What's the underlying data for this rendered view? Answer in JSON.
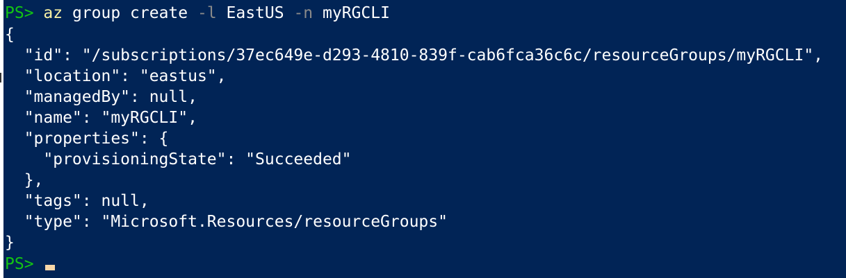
{
  "colors": {
    "background": "#012456",
    "prompt": "#13c413",
    "command": "#f9f1a5",
    "parameter": "#8a8a8a",
    "text": "#ffffff",
    "cursor": "#f8d7a8"
  },
  "command_line": {
    "prompt": "PS> ",
    "cmd": "az",
    "arg1": " group create ",
    "param1": "-l",
    "arg2": " EastUS ",
    "param2": "-n",
    "arg3": " myRGCLI"
  },
  "output": {
    "lines": [
      "{",
      "  \"id\": \"/subscriptions/37ec649e-d293-4810-839f-cab6fca36c6c/resourceGroups/myRGCLI\",",
      "  \"location\": \"eastus\",",
      "  \"managedBy\": null,",
      "  \"name\": \"myRGCLI\",",
      "  \"properties\": {",
      "    \"provisioningState\": \"Succeeded\"",
      "  },",
      "  \"tags\": null,",
      "  \"type\": \"Microsoft.Resources/resourceGroups\"",
      "}"
    ]
  },
  "final_prompt": {
    "prompt": "PS> "
  }
}
